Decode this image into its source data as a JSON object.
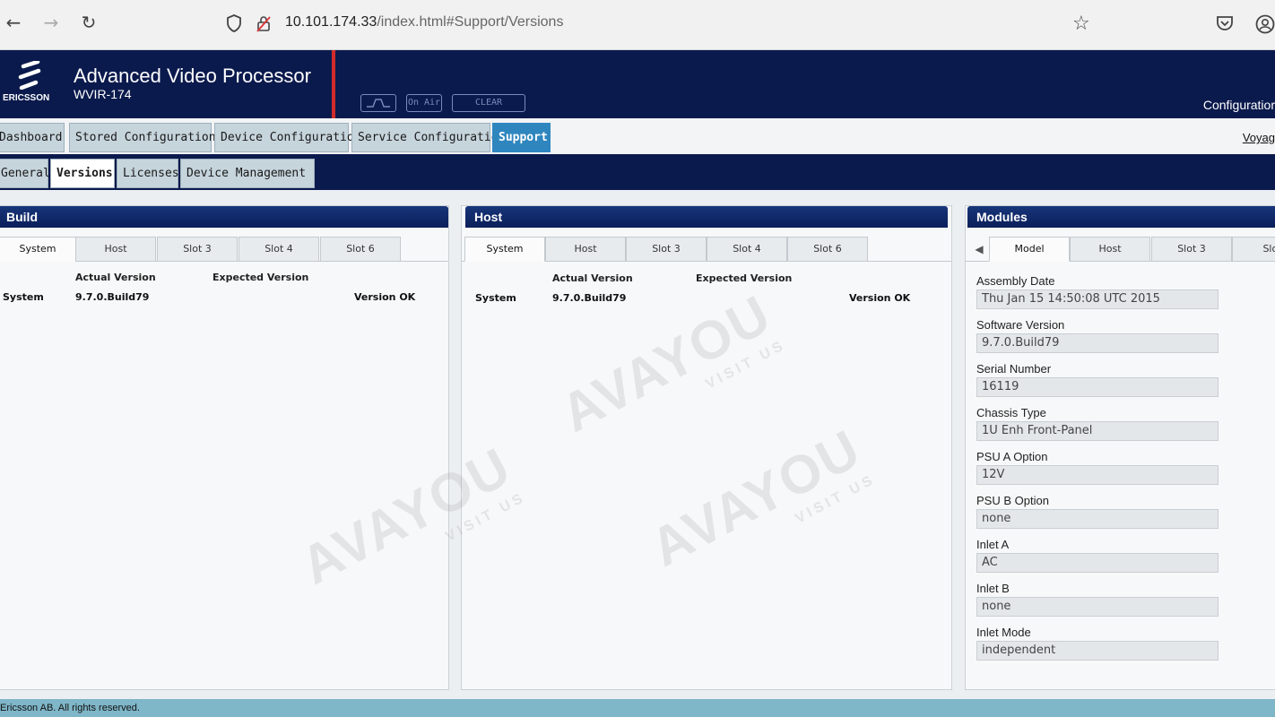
{
  "browser": {
    "url_host": "10.101.174.33",
    "url_path": "/index.html#Support/Versions"
  },
  "app": {
    "logo_text": "ERICSSON",
    "title": "Advanced Video Processor",
    "subtitle": "WVIR-174",
    "header_buttons": [
      "",
      "On Air",
      "CLEAR"
    ],
    "config_label": "Configuratior"
  },
  "top_tabs": [
    {
      "label": "Dashboard"
    },
    {
      "label": "Stored Configurations"
    },
    {
      "label": "Device Configuration"
    },
    {
      "label": "Service Configuration"
    },
    {
      "label": "Support"
    }
  ],
  "top_right_link": "Voyag",
  "sub_tabs": [
    {
      "label": "General"
    },
    {
      "label": "Versions"
    },
    {
      "label": "Licenses"
    },
    {
      "label": "Device Management"
    }
  ],
  "build": {
    "title": "Build",
    "tabs": [
      "System",
      "Host",
      "Slot 3",
      "Slot 4",
      "Slot 6"
    ],
    "col_actual": "Actual Version",
    "col_expected": "Expected Version",
    "row": {
      "name": "System",
      "actual": "9.7.0.Build79",
      "expected": "",
      "status": "Version OK"
    }
  },
  "host": {
    "title": "Host",
    "tabs": [
      "System",
      "Host",
      "Slot 3",
      "Slot 4",
      "Slot 6"
    ],
    "col_actual": "Actual Version",
    "col_expected": "Expected Version",
    "row": {
      "name": "System",
      "actual": "9.7.0.Build79",
      "expected": "",
      "status": "Version OK"
    }
  },
  "modules": {
    "title": "Modules",
    "scroll_left": "◀",
    "tabs": [
      "Model",
      "Host",
      "Slot 3",
      "Slot"
    ],
    "fields": [
      {
        "label": "Assembly Date",
        "value": "Thu Jan 15 14:50:08 UTC 2015"
      },
      {
        "label": "Software Version",
        "value": "9.7.0.Build79"
      },
      {
        "label": "Serial Number",
        "value": "16119"
      },
      {
        "label": "Chassis Type",
        "value": "1U Enh Front-Panel"
      },
      {
        "label": "PSU A Option",
        "value": "12V"
      },
      {
        "label": "PSU B Option",
        "value": "none"
      },
      {
        "label": "Inlet A",
        "value": "AC"
      },
      {
        "label": "Inlet B",
        "value": "none"
      },
      {
        "label": "Inlet Mode",
        "value": "independent"
      }
    ]
  },
  "footer": {
    "text": "Ericsson AB. All rights reserved."
  },
  "watermark": {
    "text": "AVAYOU",
    "sub": "VISIT US"
  }
}
